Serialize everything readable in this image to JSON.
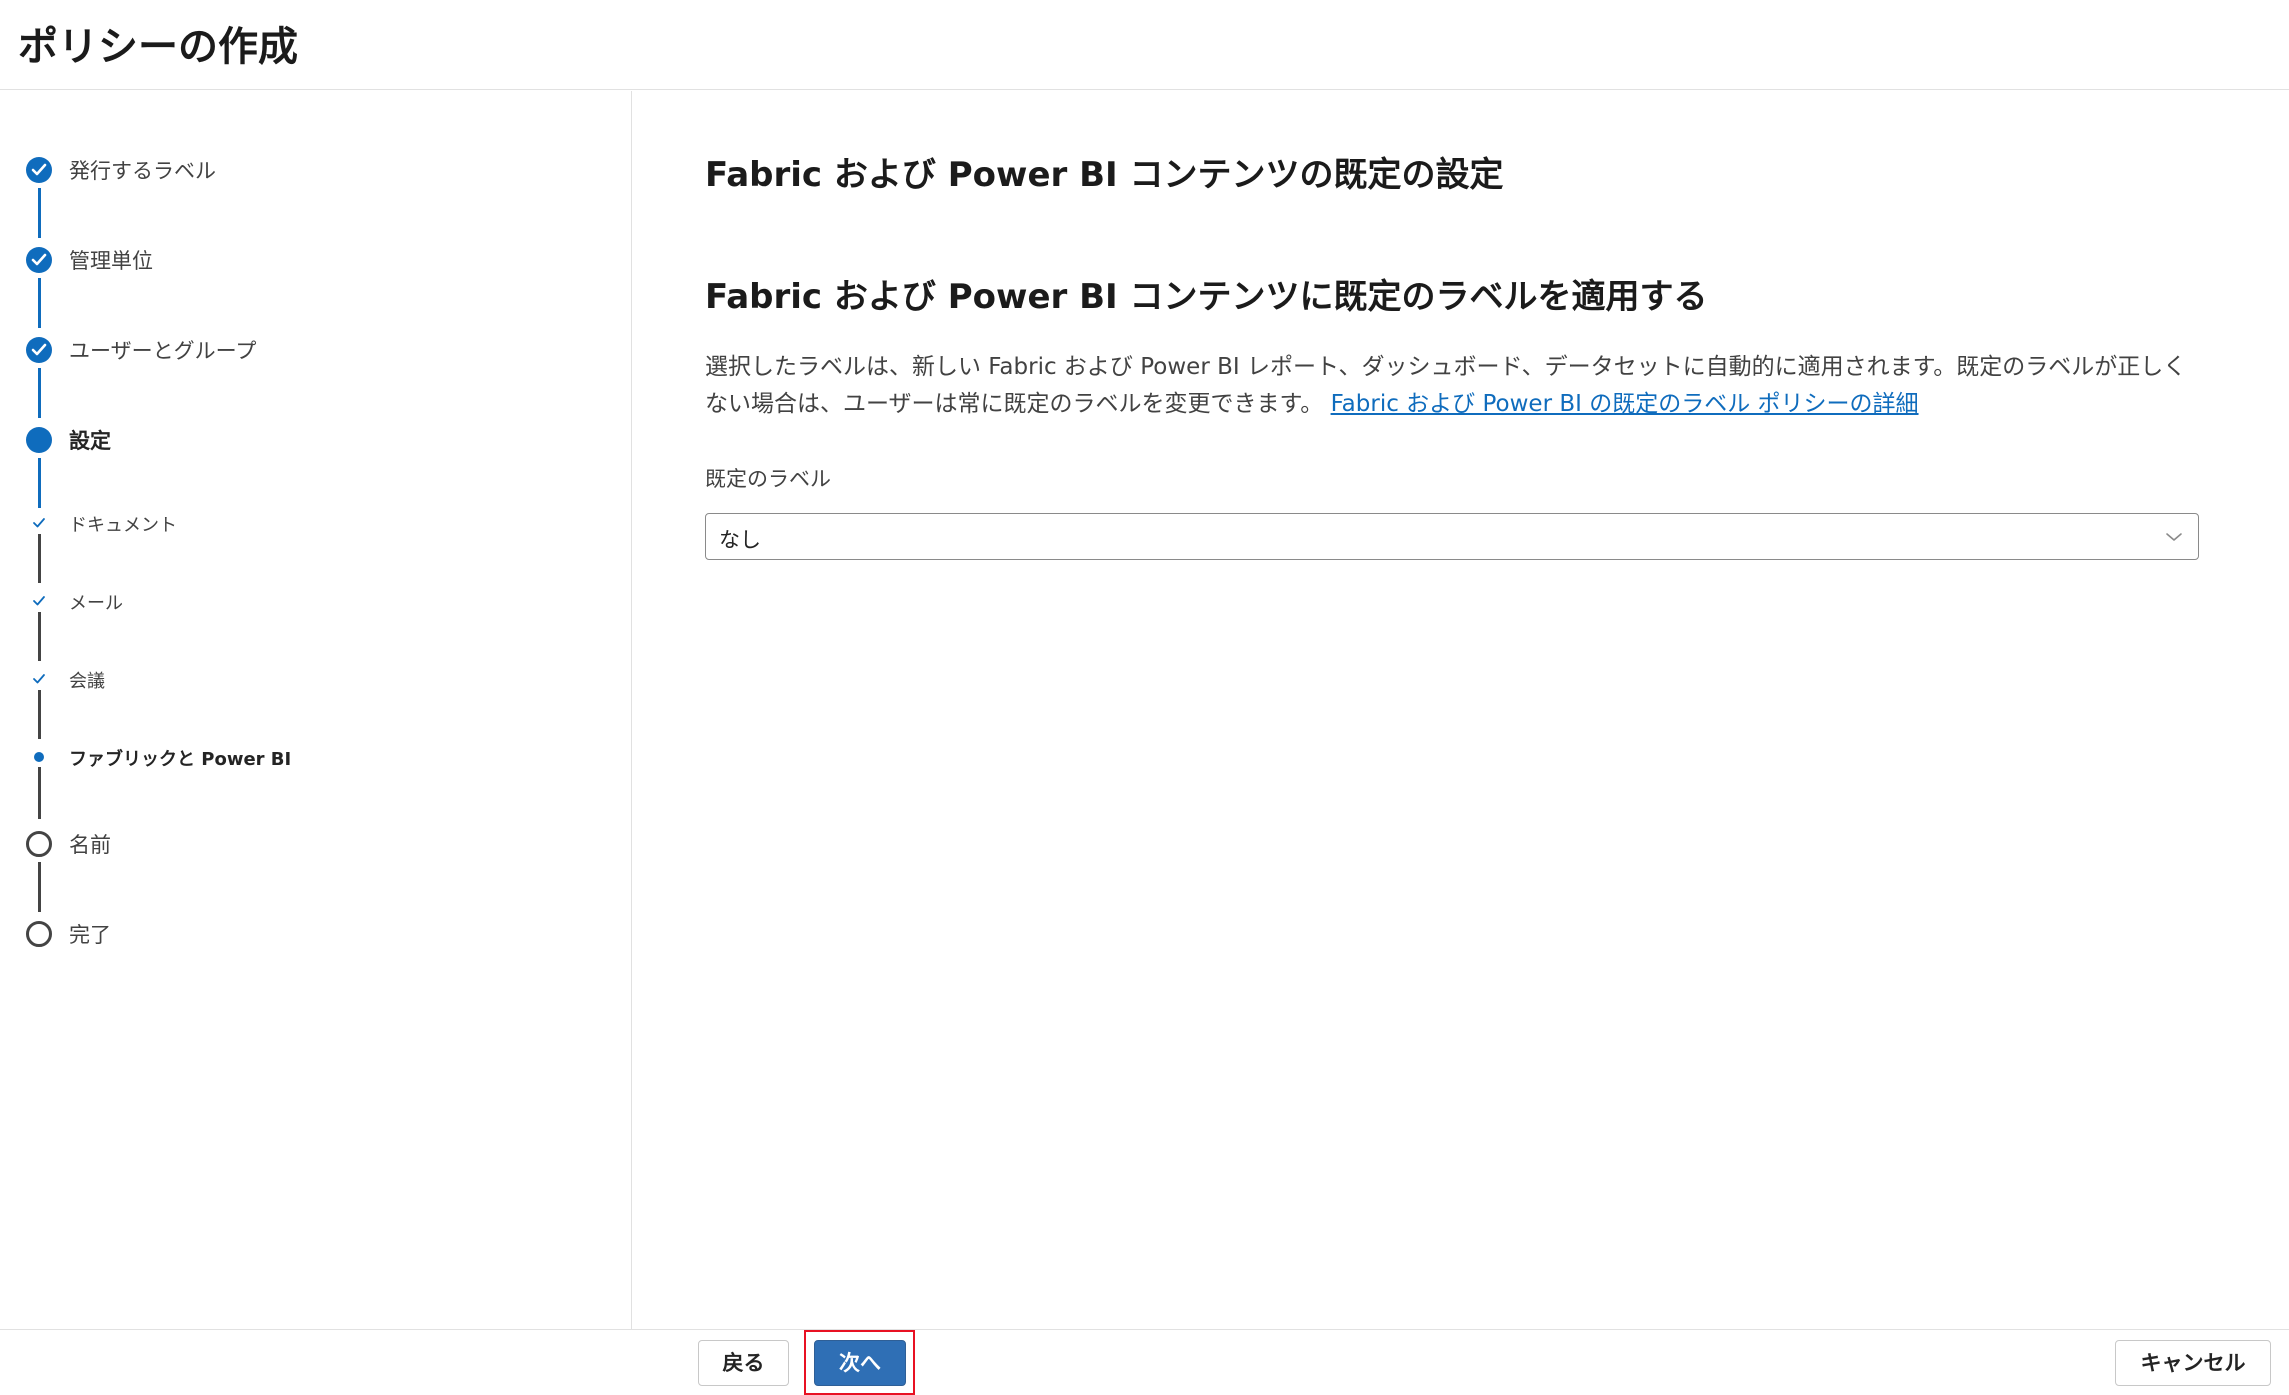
{
  "page": {
    "title": "ポリシーの作成"
  },
  "steps": [
    {
      "label": "発行するラベル",
      "state": "done"
    },
    {
      "label": "管理単位",
      "state": "done"
    },
    {
      "label": "ユーザーとグループ",
      "state": "done"
    },
    {
      "label": "設定",
      "state": "current"
    },
    {
      "label": "ドキュメント",
      "state": "sub-done"
    },
    {
      "label": "メール",
      "state": "sub-done"
    },
    {
      "label": "会議",
      "state": "sub-done"
    },
    {
      "label": "ファブリックと Power BI",
      "state": "sub-current"
    },
    {
      "label": "名前",
      "state": "todo"
    },
    {
      "label": "完了",
      "state": "todo"
    }
  ],
  "main": {
    "section_title": "Fabric および Power BI コンテンツの既定の設定",
    "sub_title": "Fabric および Power BI コンテンツに既定のラベルを適用する",
    "description": "選択したラベルは、新しい Fabric および Power BI レポート、ダッシュボード、データセットに自動的に適用されます。既定のラベルが正しくない場合は、ユーザーは常に既定のラベルを変更できます。 ",
    "link_text": "Fabric および Power BI の既定のラベル ポリシーの詳細",
    "field_label": "既定のラベル",
    "dropdown_value": "なし"
  },
  "footer": {
    "back_label": "戻る",
    "next_label": "次へ",
    "cancel_label": "キャンセル"
  },
  "colors": {
    "accent": "#0f6cbd",
    "primary_button": "#2f6fb5",
    "highlight": "#e81123"
  }
}
